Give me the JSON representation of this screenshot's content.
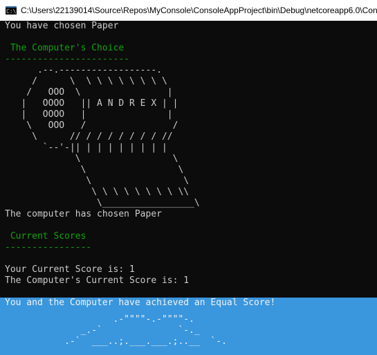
{
  "window": {
    "title": "C:\\Users\\22139014\\Source\\Repos\\MyConsole\\ConsoleAppProject\\bin\\Debug\\netcoreapp6.0\\Con",
    "icon_text": "C:\\"
  },
  "colors": {
    "background": "#0c0c0c",
    "text": "#cccccc",
    "green": "#13a10e",
    "highlight": "#3a96dd"
  },
  "console": {
    "player_choice": "You have chosen Paper",
    "computer_choice_heading": " The Computer's Choice",
    "computer_choice_underline": "-----------------------",
    "paper_art": [
      "      .--.------------------.",
      "     /      \\  \\ \\ \\ \\ \\ \\ \\ \\",
      "    /   OOO  \\                |",
      "   |   OOOO   || A N D R E X | |",
      "   |   OOOO   |               |",
      "    \\   OOO   /                /",
      "     \\      // / / / / / / / //",
      "       `--'-|| | | | | | | | |",
      "             \\                 \\",
      "              \\                 \\",
      "               \\                 \\",
      "                \\ \\ \\ \\ \\ \\ \\ \\ \\\\",
      "                 \\_________________\\"
    ],
    "computer_result": "The computer has chosen Paper",
    "scores_heading": " Current Scores",
    "scores_underline": "----------------",
    "your_score": "Your Current Score is: 1",
    "computer_score": "The Computer's Current Score is: 1",
    "result_message": "You and the Computer have achieved an Equal Score!",
    "result_art": [
      "                    .-\"\"\"\"-.-\"\"\"\"-.",
      "              _.-`              `-._",
      "           .-`  ___..;.___.___.;..__  `-."
    ]
  }
}
